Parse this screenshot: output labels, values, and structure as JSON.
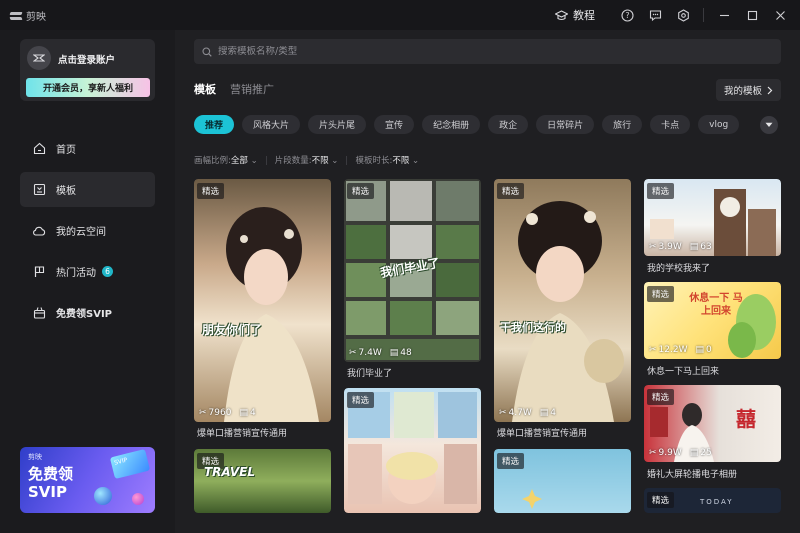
{
  "titlebar": {
    "app_name": "剪映",
    "tutorial_label": "教程"
  },
  "sidebar": {
    "login_text": "点击登录账户",
    "vip_banner": "开通会员，享新人福利",
    "nav": [
      {
        "label": "首页",
        "icon": "home-icon"
      },
      {
        "label": "模板",
        "icon": "template-icon"
      },
      {
        "label": "我的云空间",
        "icon": "cloud-icon"
      },
      {
        "label": "热门活动",
        "icon": "flag-icon",
        "badge": "6"
      },
      {
        "label": "免费领SVIP",
        "icon": "gift-icon"
      }
    ],
    "promo": {
      "brand": "剪映",
      "line1": "免费领",
      "line2": "SVIP",
      "card_text": "SVIP"
    }
  },
  "search": {
    "placeholder": "搜索模板名称/类型"
  },
  "tabs": [
    "模板",
    "营销推广"
  ],
  "my_templates_label": "我的模板",
  "chips": [
    "推荐",
    "风格大片",
    "片头片尾",
    "宣传",
    "纪念相册",
    "政企",
    "日常碎片",
    "旅行",
    "卡点",
    "vlog"
  ],
  "filters": [
    {
      "label": "画幅比例:",
      "value": "全部"
    },
    {
      "label": "片段数量:",
      "value": "不限"
    },
    {
      "label": "模板时长:",
      "value": "不限"
    }
  ],
  "cards": {
    "c1": {
      "tag": "精选",
      "likes": "7960",
      "clips": "4",
      "title": "爆单口播营销宣传通用",
      "overlay": "朋友你们了"
    },
    "c2": {
      "tag": "精选",
      "likes": "7.4W",
      "clips": "48",
      "title": "我们毕业了",
      "overlay": "我们毕业了"
    },
    "c3": {
      "tag": "精选",
      "likes": "4.7W",
      "clips": "4",
      "title": "爆单口播营销宣传通用",
      "overlay": "干我们这行的"
    },
    "c4": {
      "tag": "精选",
      "likes": "3.9W",
      "clips": "63",
      "title": "我的学校我来了"
    },
    "c5": {
      "tag": "精选",
      "likes": "12.2W",
      "clips": "0",
      "title": "休息一下马上回来",
      "overlay": "休息一下 马上回来"
    },
    "c6": {
      "tag": "精选",
      "likes": "9.9W",
      "clips": "25",
      "title": "婚礼大屏轮播电子相册",
      "overlay": "囍"
    },
    "c7": {
      "tag": "精选",
      "overlay": "TRAVEL"
    },
    "c8": {
      "tag": "精选"
    },
    "c9": {
      "tag": "精选"
    },
    "c10": {
      "tag": "精选",
      "overlay": "TODAY"
    }
  }
}
